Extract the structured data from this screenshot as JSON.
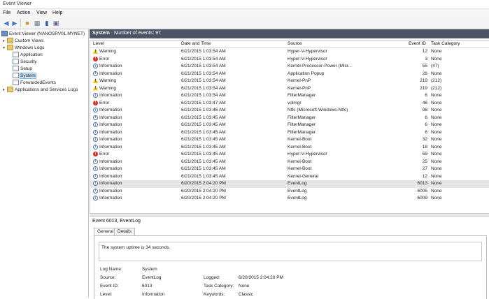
{
  "window": {
    "title": "Event Viewer"
  },
  "menu": [
    "File",
    "Action",
    "View",
    "Help"
  ],
  "toolbar": {
    "icons": [
      "back-arrow-icon",
      "forward-arrow-icon",
      "folder-icon",
      "properties-icon",
      "help-icon",
      "panel-icon"
    ]
  },
  "tree": {
    "root": "Event Viewer (NANOSRV01.MYNET)",
    "custom_views": "Custom Views",
    "windows_logs": "Windows Logs",
    "application": "Application",
    "security": "Security",
    "setup": "Setup",
    "system": "System",
    "forwarded": "ForwardedEvents",
    "apps_services": "Applications and Services Logs"
  },
  "log_header": {
    "name": "System",
    "count": "Number of events: 97"
  },
  "columns": {
    "level": "Level",
    "datetime": "Date and Time",
    "source": "Source",
    "event_id": "Event ID",
    "task": "Task Category"
  },
  "rows": [
    {
      "level": "Warning",
      "icon": "warning",
      "dt": "6/21/2015 1:03:54 AM",
      "source": "Hyper-V-Hypervisor",
      "id": "12",
      "task": "None"
    },
    {
      "level": "Error",
      "icon": "error",
      "dt": "6/21/2015 1:03:54 AM",
      "source": "Hyper-V-Hypervisor",
      "id": "3",
      "task": "None"
    },
    {
      "level": "Information",
      "icon": "information",
      "dt": "6/21/2015 1:03:54 AM",
      "source": "Kernel-Processor-Power (Micr...",
      "id": "55",
      "task": "(47)"
    },
    {
      "level": "Information",
      "icon": "information",
      "dt": "6/21/2015 1:03:54 AM",
      "source": "Application Popup",
      "id": "26",
      "task": "None"
    },
    {
      "level": "Warning",
      "icon": "warning",
      "dt": "6/21/2015 1:03:54 AM",
      "source": "Kernel-PnP",
      "id": "219",
      "task": "(212)"
    },
    {
      "level": "Warning",
      "icon": "warning",
      "dt": "6/21/2015 1:03:54 AM",
      "source": "Kernel-PnP",
      "id": "219",
      "task": "(212)"
    },
    {
      "level": "Information",
      "icon": "information",
      "dt": "6/21/2015 1:03:54 AM",
      "source": "FilterManager",
      "id": "6",
      "task": "None"
    },
    {
      "level": "Error",
      "icon": "error",
      "dt": "6/21/2015 1:03:47 AM",
      "source": "volmgr",
      "id": "46",
      "task": "None"
    },
    {
      "level": "Information",
      "icon": "information",
      "dt": "6/21/2015 1:03:46 AM",
      "source": "Ntfs (Microsoft-Windows-Ntfs)",
      "id": "98",
      "task": "None"
    },
    {
      "level": "Information",
      "icon": "information",
      "dt": "6/21/2015 1:03:45 AM",
      "source": "FilterManager",
      "id": "6",
      "task": "None"
    },
    {
      "level": "Information",
      "icon": "information",
      "dt": "6/21/2015 1:03:45 AM",
      "source": "FilterManager",
      "id": "6",
      "task": "None"
    },
    {
      "level": "Information",
      "icon": "information",
      "dt": "6/21/2015 1:03:45 AM",
      "source": "FilterManager",
      "id": "6",
      "task": "None"
    },
    {
      "level": "Information",
      "icon": "information",
      "dt": "6/21/2015 1:03:45 AM",
      "source": "Kernel-Boot",
      "id": "32",
      "task": "None"
    },
    {
      "level": "Information",
      "icon": "information",
      "dt": "6/21/2015 1:03:45 AM",
      "source": "Kernel-Boot",
      "id": "18",
      "task": "None"
    },
    {
      "level": "Error",
      "icon": "error",
      "dt": "6/21/2015 1:03:45 AM",
      "source": "Hyper-V-Hypervisor",
      "id": "59",
      "task": "None"
    },
    {
      "level": "Information",
      "icon": "information",
      "dt": "6/21/2015 1:03:45 AM",
      "source": "Kernel-Boot",
      "id": "25",
      "task": "None"
    },
    {
      "level": "Information",
      "icon": "information",
      "dt": "6/21/2015 1:03:45 AM",
      "source": "Kernel-Boot",
      "id": "27",
      "task": "None"
    },
    {
      "level": "Information",
      "icon": "information",
      "dt": "6/21/2015 1:03:45 AM",
      "source": "Kernel-General",
      "id": "12",
      "task": "None"
    },
    {
      "level": "Information",
      "icon": "information",
      "dt": "6/20/2015 2:04:20 PM",
      "source": "EventLog",
      "id": "6013",
      "task": "None",
      "selected": true
    },
    {
      "level": "Information",
      "icon": "information",
      "dt": "6/20/2015 2:04:20 PM",
      "source": "EventLog",
      "id": "6005",
      "task": "None"
    },
    {
      "level": "Information",
      "icon": "information",
      "dt": "6/20/2015 2:04:20 PM",
      "source": "EventLog",
      "id": "6009",
      "task": "None"
    }
  ],
  "detail": {
    "title": "Event 6013, EventLog",
    "tab_general": "General",
    "tab_details": "Details",
    "message": "The system uptime is 34 seconds.",
    "log_name_label": "Log Name:",
    "log_name": "System",
    "source_label": "Source:",
    "source": "EventLog",
    "logged_label": "Logged:",
    "logged": "6/20/2015 2:04:20 PM",
    "event_id_label": "Event ID:",
    "event_id": "6013",
    "task_label": "Task Category:",
    "task": "None",
    "level_label": "Level:",
    "level": "Information",
    "keywords_label": "Keywords:",
    "keywords": "Classic"
  }
}
